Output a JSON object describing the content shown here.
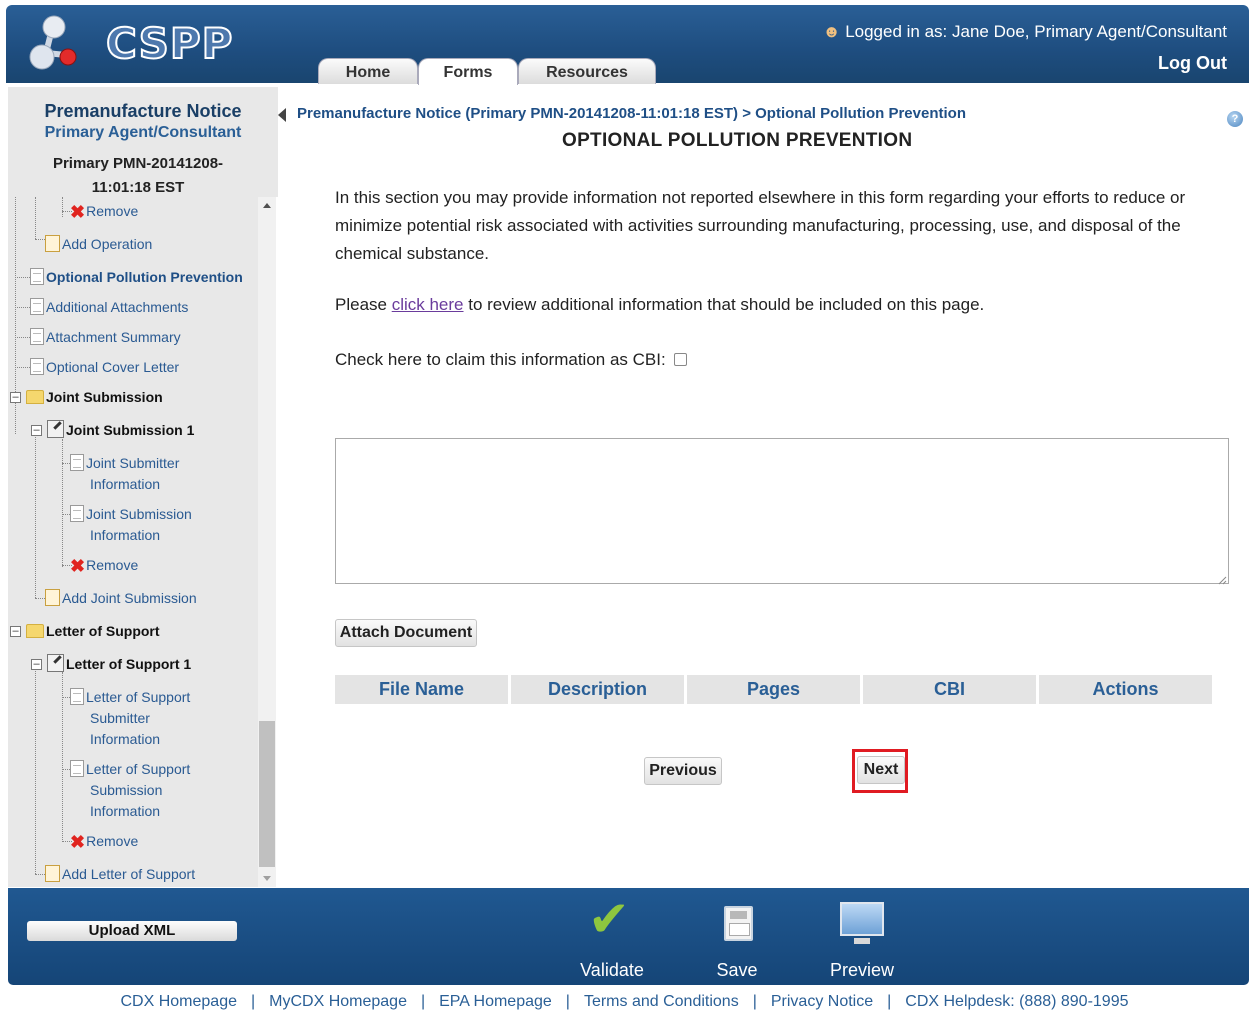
{
  "header": {
    "logo_text": "CSPP",
    "logged_in_label": "Logged in as:",
    "user_name": "Jane Doe, Primary Agent/Consultant",
    "logout_label": "Log Out",
    "tabs": [
      {
        "label": "Home",
        "active": false
      },
      {
        "label": "Forms",
        "active": true
      },
      {
        "label": "Resources",
        "active": false
      }
    ]
  },
  "sidebar": {
    "title": "Premanufacture Notice",
    "role": "Primary Agent/Consultant",
    "pmn": "Primary PMN-20141208-11:01:18 EST",
    "items": {
      "remove1": "Remove",
      "add_operation": "Add Operation",
      "optional_pollution_prevention": "Optional Pollution Prevention",
      "additional_attachments": "Additional Attachments",
      "attachment_summary": "Attachment Summary",
      "optional_cover_letter": "Optional Cover Letter",
      "joint_submission": "Joint Submission",
      "joint_submission_1": "Joint Submission 1",
      "joint_submitter_info_1": "Joint Submitter",
      "joint_submitter_info_2": "Information",
      "joint_submission_info_1": "Joint Submission",
      "joint_submission_info_2": "Information",
      "remove2": "Remove",
      "add_joint_submission": "Add Joint Submission",
      "letter_of_support": "Letter of Support",
      "letter_of_support_1": "Letter of Support 1",
      "los_submitter_1": "Letter of Support",
      "los_submitter_2": "Submitter",
      "los_submitter_3": "Information",
      "los_submission_1": "Letter of Support",
      "los_submission_2": "Submission",
      "los_submission_3": "Information",
      "remove3": "Remove",
      "add_letter_of_support": "Add Letter of Support"
    }
  },
  "breadcrumb": {
    "parent": "Premanufacture Notice (Primary PMN-20141208-11:01:18 EST)",
    "separator": ">",
    "current": "Optional Pollution Prevention"
  },
  "main": {
    "title": "OPTIONAL POLLUTION PREVENTION",
    "intro": "In this section you may provide information not reported elsewhere in this form regarding your efforts to reduce or minimize potential risk associated with activities surrounding manufacturing, processing, use, and disposal of the chemical substance.",
    "review_prefix": "Please ",
    "review_link": "click here",
    "review_suffix": " to review additional information that should be included on this page.",
    "cbi_label": "Check here to claim this information as CBI:",
    "textarea_value": "",
    "attach_button": "Attach Document",
    "table_headers": [
      "File Name",
      "Description",
      "Pages",
      "CBI",
      "Actions"
    ],
    "previous_button": "Previous",
    "next_button": "Next"
  },
  "toolbar": {
    "upload_xml": "Upload XML",
    "validate": "Validate",
    "save": "Save",
    "preview": "Preview"
  },
  "footer_links": [
    "CDX Homepage",
    "MyCDX Homepage",
    "EPA Homepage",
    "Terms and Conditions",
    "Privacy Notice",
    "CDX Helpdesk: (888) 890-1995"
  ],
  "colors": {
    "header_blue": "#1e4d7f",
    "link_blue": "#1f4f86",
    "highlight_red": "#e01b22",
    "validate_green": "#8ec63f"
  }
}
